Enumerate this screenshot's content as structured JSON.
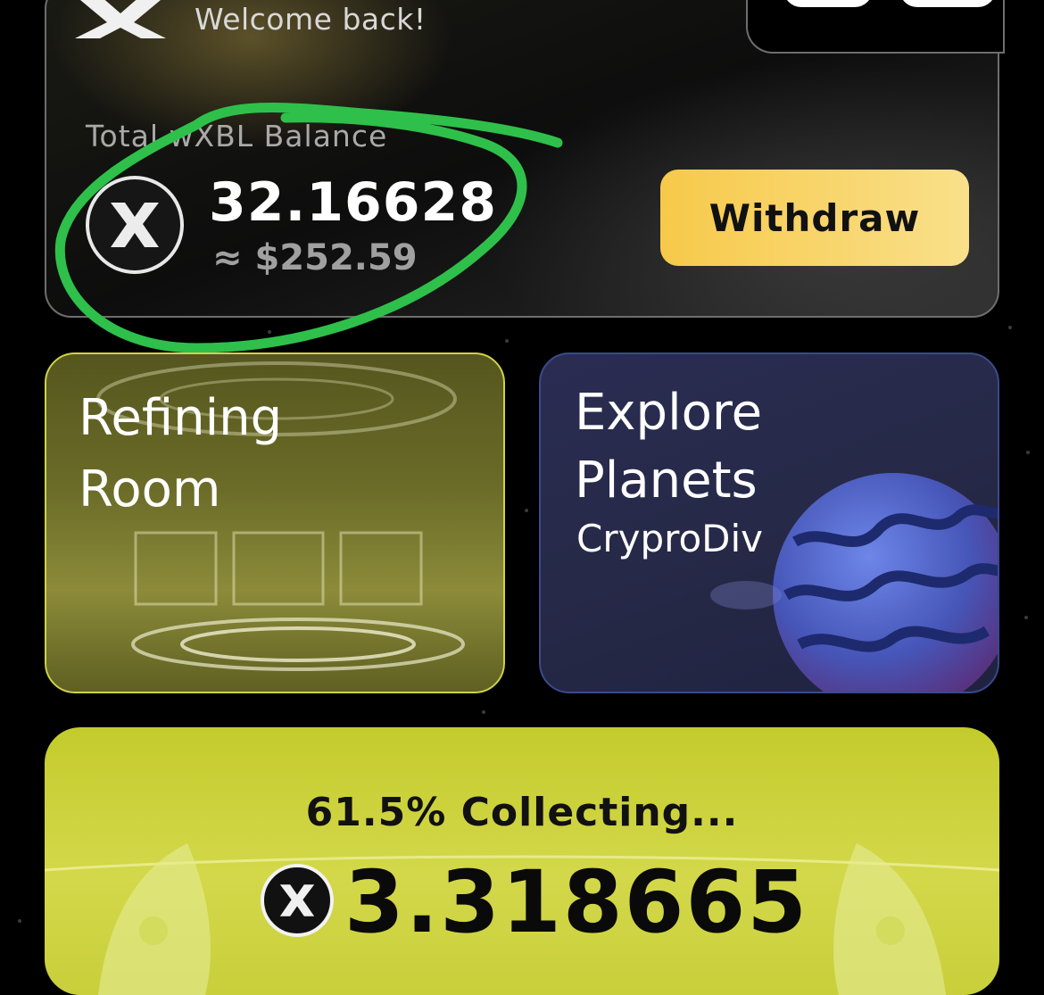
{
  "header": {
    "welcome_text": "Welcome back!"
  },
  "balance": {
    "label": "Total wXBL Balance",
    "amount": "32.16628",
    "usd_value": "≈ $252.59",
    "withdraw_label": "Withdraw"
  },
  "cards": {
    "refining": {
      "title_line1": "Refining",
      "title_line2": "Room"
    },
    "explore": {
      "title_line1": "Explore",
      "title_line2": "Planets",
      "subtitle": "CryproDiv"
    }
  },
  "collecting": {
    "progress_percent": 61.5,
    "label": "61.5% Collecting...",
    "amount": "3.318665"
  },
  "colors": {
    "accent_yellow": "#f7c94a",
    "lime": "#c4cb2c",
    "annotation_green": "#2ec04a"
  }
}
